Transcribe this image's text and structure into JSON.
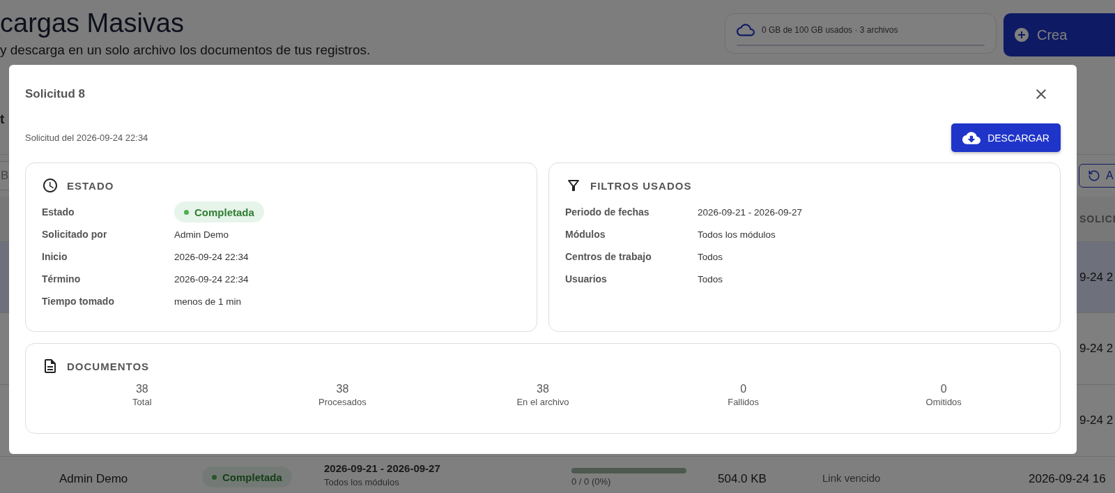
{
  "background": {
    "title": "cargas Masivas",
    "subtitle": "y descarga en un solo archivo los documentos de tus registros.",
    "storage": {
      "text": "0 GB de 100 GB usados · 3 archivos",
      "level": 0
    },
    "create_button": "Crea",
    "tab": "t",
    "search": {
      "placeholder": "B"
    },
    "refresh_button": "A",
    "table": {
      "column_header": "SOLICI",
      "rows": [
        {
          "kind": "partial",
          "selected": true,
          "requested": "9-24 2"
        },
        {
          "kind": "partial",
          "selected": false,
          "requested": "9-24 2"
        },
        {
          "kind": "partial",
          "selected": false,
          "requested": "9-24 2"
        },
        {
          "kind": "full",
          "selected": false,
          "user": "Admin Demo",
          "status": "Completada",
          "dates": "2026-09-21 - 2026-09-27",
          "modules": "Todos los módulos",
          "progress": {
            "level": 1,
            "text": "0 / 0 (0%)"
          },
          "size": "504.0 KB",
          "link": "Link vencido",
          "requested": "2026-09-24 16"
        }
      ]
    }
  },
  "modal": {
    "title": "Solicitud 8",
    "subtitle": "Solicitud del 2026-09-24 22:34",
    "download_button": "DESCARGAR",
    "status_card": {
      "heading": "ESTADO",
      "fields": [
        {
          "label": "Estado",
          "value": "Completada",
          "kind": "badge"
        },
        {
          "label": "Solicitado por",
          "value": "Admin Demo",
          "kind": "text"
        },
        {
          "label": "Inicio",
          "value": "2026-09-24 22:34",
          "kind": "text"
        },
        {
          "label": "Término",
          "value": "2026-09-24 22:34",
          "kind": "text"
        },
        {
          "label": "Tiempo tomado",
          "value": "menos de 1 min",
          "kind": "text"
        }
      ]
    },
    "filters_card": {
      "heading": "FILTROS USADOS",
      "fields": [
        {
          "label": "Periodo de fechas",
          "value": "2026-09-21 - 2026-09-27",
          "kind": "text"
        },
        {
          "label": "Módulos",
          "value": "Todos los módulos",
          "kind": "text"
        },
        {
          "label": "Centros de trabajo",
          "value": "Todos",
          "kind": "text"
        },
        {
          "label": "Usuarios",
          "value": "Todos",
          "kind": "text"
        }
      ]
    },
    "documents_card": {
      "heading": "DOCUMENTOS",
      "stats": [
        {
          "value": "38",
          "label": "Total"
        },
        {
          "value": "38",
          "label": "Procesados"
        },
        {
          "value": "38",
          "label": "En el archivo"
        },
        {
          "value": "0",
          "label": "Fallidos"
        },
        {
          "value": "0",
          "label": "Omitidos"
        }
      ]
    }
  }
}
